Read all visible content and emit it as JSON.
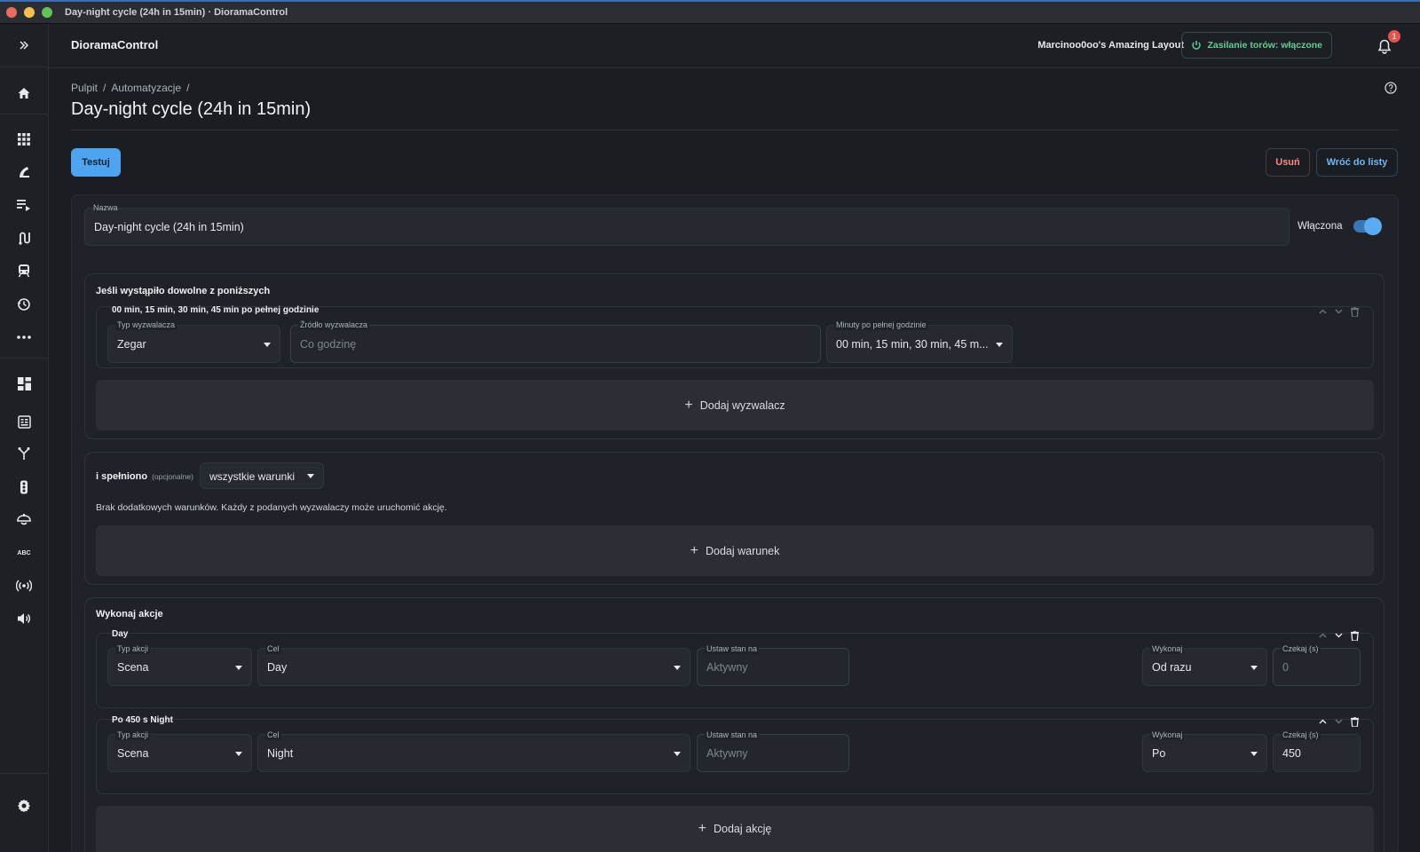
{
  "window": {
    "title": "Day-night cycle (24h in 15min) · DioramaControl"
  },
  "header": {
    "app_name": "DioramaControl",
    "layout_name": "Marcinoo0oo's Amazing Layout",
    "power_label": "Zasilanie torów: włączone",
    "notifications_count": "1"
  },
  "sidebar": {
    "items": [
      {
        "icon": "expand-icon"
      },
      {
        "icon": "home-icon"
      },
      {
        "icon": "grid-icon"
      },
      {
        "icon": "turnout-icon"
      },
      {
        "icon": "playlist-icon"
      },
      {
        "icon": "routes-icon"
      },
      {
        "icon": "train-icon"
      },
      {
        "icon": "automation-icon"
      },
      {
        "icon": "more-icon"
      },
      {
        "icon": "dashboard-icon"
      },
      {
        "icon": "panel-icon"
      },
      {
        "icon": "branch-icon"
      },
      {
        "icon": "traffic-light-icon"
      },
      {
        "icon": "lamp-icon"
      },
      {
        "icon": "abc-icon"
      },
      {
        "icon": "broadcast-icon"
      },
      {
        "icon": "sound-icon"
      },
      {
        "icon": "settings-icon"
      }
    ],
    "abc_text": "ABC"
  },
  "breadcrumb": {
    "items": [
      "Pulpit",
      "Automatyzacje"
    ],
    "sep": "/"
  },
  "page": {
    "title": "Day-night cycle (24h in 15min)",
    "test_label": "Testuj",
    "delete_label": "Usuń",
    "back_label": "Wróć do listy"
  },
  "form": {
    "name_label": "Nazwa",
    "name_value": "Day-night cycle (24h in 15min)",
    "enabled_label": "Włączona",
    "enabled": true
  },
  "triggers": {
    "title": "Jeśli wystąpiło dowolne z poniższych",
    "items": [
      {
        "title": "00 min, 15 min, 30 min, 45 min po pełnej godzinie",
        "type_label": "Typ wyzwalacza",
        "type_value": "Zegar",
        "source_label": "Źródło wyzwalacza",
        "source_value": "Co godzinę",
        "minutes_label": "Minuty po pełnej godzinie",
        "minutes_value": "00 min, 15 min, 30 min, 45 m..."
      }
    ],
    "add_label": "Dodaj wyzwalacz"
  },
  "conditions": {
    "title": "i spełniono",
    "optional": "(opcjonalne)",
    "mode_value": "wszystkie warunki",
    "info": "Brak dodatkowych warunków. Każdy z podanych wyzwalaczy może uruchomić akcję.",
    "add_label": "Dodaj warunek"
  },
  "actions": {
    "title": "Wykonaj akcje",
    "items": [
      {
        "title": "Day",
        "type_label": "Typ akcji",
        "type_value": "Scena",
        "target_label": "Cel",
        "target_value": "Day",
        "state_label": "Ustaw stan na",
        "state_value": "Aktywny",
        "exec_label": "Wykonaj",
        "exec_value": "Od razu",
        "wait_label": "Czekaj (s)",
        "wait_value": "0"
      },
      {
        "title": "Po 450 s Night",
        "type_label": "Typ akcji",
        "type_value": "Scena",
        "target_label": "Cel",
        "target_value": "Night",
        "state_label": "Ustaw stan na",
        "state_value": "Aktywny",
        "exec_label": "Wykonaj",
        "exec_value": "Po",
        "wait_label": "Czekaj (s)",
        "wait_value": "450"
      }
    ],
    "add_label": "Dodaj akcję"
  },
  "colors": {
    "accent": "#4ea4ef",
    "power_on": "#5fd08f",
    "danger": "#ff8a85",
    "badge": "#e5534b"
  }
}
